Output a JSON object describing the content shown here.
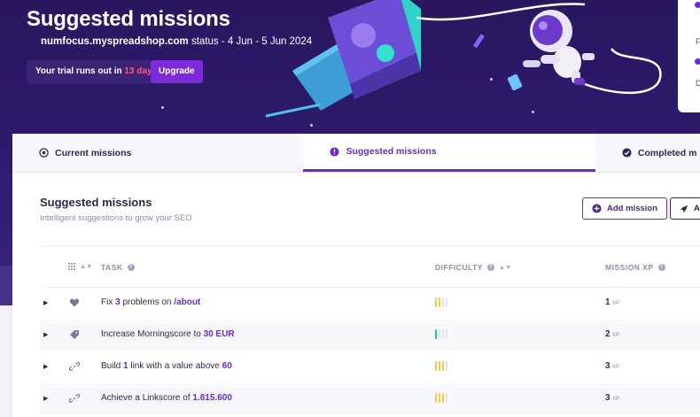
{
  "hero": {
    "title": "Suggested missions",
    "site": "numfocus.myspreadshop.com",
    "status_text": " status - 4 Jun - 5 Jun 2024",
    "trial_prefix": "Your trial runs out in ",
    "trial_days": "13 days",
    "upgrade_label": "Upgrade"
  },
  "side_card": {
    "labels": [
      "F",
      "D"
    ]
  },
  "tabs": [
    {
      "label": "Current missions",
      "icon": "target-icon"
    },
    {
      "label": "Suggested missions",
      "icon": "exclamation-circle-icon",
      "active": true
    },
    {
      "label": "Completed m",
      "icon": "check-circle-icon"
    }
  ],
  "section": {
    "title": "Suggested missions",
    "subtitle": "Intelligent suggestions to grow your SEO",
    "add_button": "Add mission",
    "all_button": "Al"
  },
  "table": {
    "headers": {
      "task": "TASK",
      "difficulty": "DIFFICULTY",
      "xp": "MISSION XP"
    },
    "xp_unit": "XP",
    "rows": [
      {
        "icon": "heart-icon",
        "pre": "Fix ",
        "num": "3",
        "mid": " problems on ",
        "hl": "/about",
        "difficulty": 2,
        "color": "yellow",
        "xp": "1"
      },
      {
        "icon": "tag-icon",
        "pre": "Increase Morningscore to ",
        "num": "",
        "mid": "",
        "hl": "30 EUR",
        "difficulty": 1,
        "color": "green",
        "xp": "2"
      },
      {
        "icon": "link-icon",
        "pre": "Build ",
        "num": "1",
        "mid": " link with a value above ",
        "hl": "60",
        "difficulty": 3,
        "color": "yellow",
        "xp": "3"
      },
      {
        "icon": "link-icon",
        "pre": "Achieve a Linkscore of ",
        "num": "",
        "mid": "",
        "hl": "1.815.600",
        "difficulty": 3,
        "color": "yellow",
        "xp": "3"
      }
    ]
  },
  "colors": {
    "accent": "#6a2bc9",
    "hero_bg": "#2d1a6b",
    "alert": "#ff5a7a",
    "easy": "#1cc89a",
    "medium": "#f2c94c"
  }
}
